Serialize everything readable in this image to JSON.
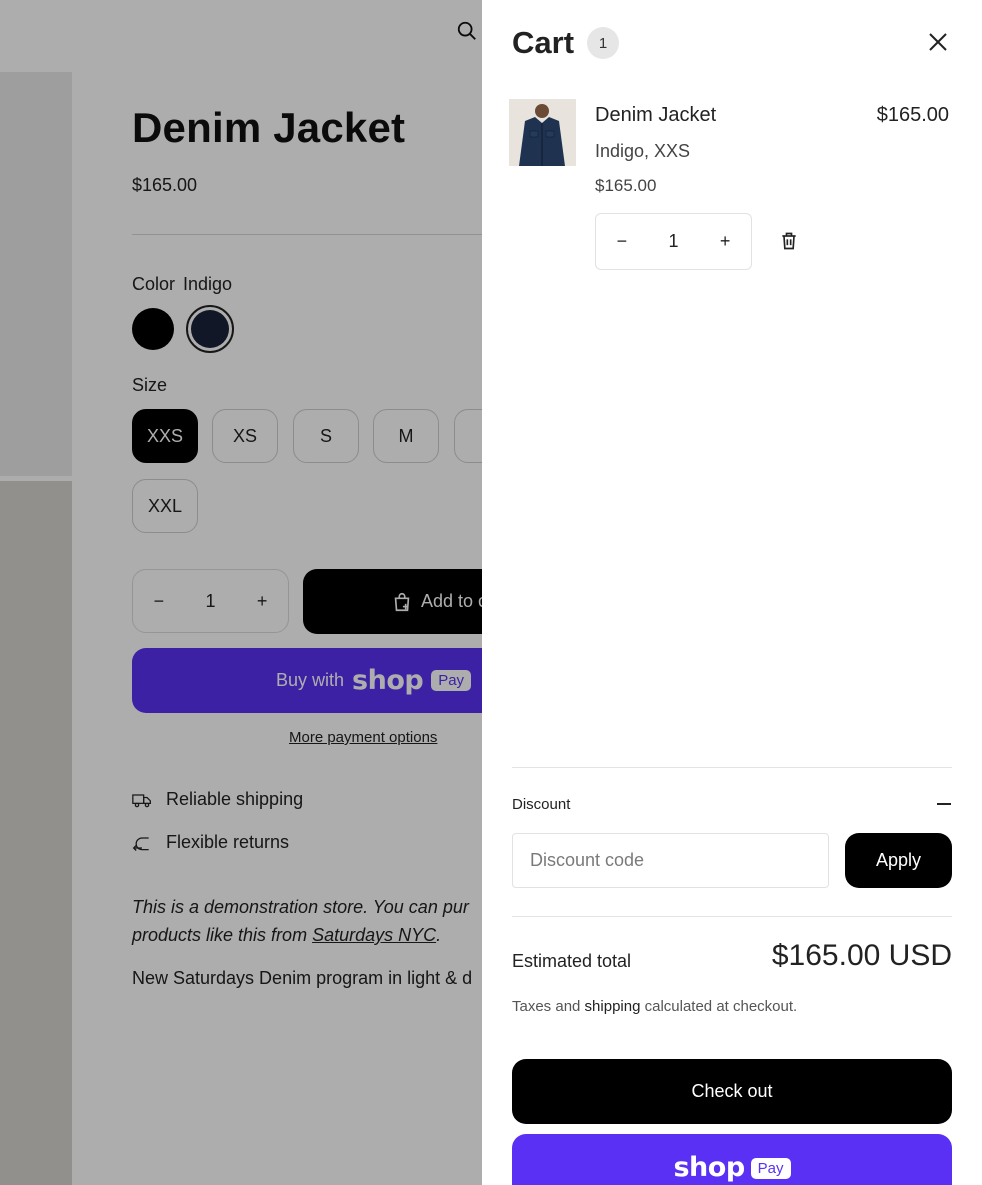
{
  "product": {
    "title": "Denim Jacket",
    "price": "$165.00",
    "color_label": "Color",
    "color_value": "Indigo",
    "size_label": "Size",
    "sizes": [
      "XXS",
      "XS",
      "S",
      "M",
      "XXL"
    ],
    "selected_size": "XXS",
    "quantity": "1",
    "add_to_cart_label": "Add to c",
    "buy_with_label": "Buy with",
    "shop_word": "shop",
    "pay_word": "Pay",
    "more_payment_options": "More payment options",
    "features": [
      "Reliable shipping",
      "Flexible returns"
    ],
    "description_italic_1": "This is a demonstration store. You can pur",
    "description_italic_2_prefix": "products like this from ",
    "description_link": "Saturdays NYC",
    "description_italic_2_suffix": ".",
    "description_plain": "New Saturdays Denim program in light & d"
  },
  "cart": {
    "title": "Cart",
    "count": "1",
    "item": {
      "name": "Denim Jacket",
      "line_price": "$165.00",
      "variant": "Indigo, XXS",
      "unit_price": "$165.00",
      "quantity": "1"
    },
    "discount_label": "Discount",
    "discount_placeholder": "Discount code",
    "apply_label": "Apply",
    "estimated_total_label": "Estimated total",
    "estimated_total_value": "$165.00 USD",
    "tax_note_prefix": "Taxes and ",
    "tax_note_link": "shipping",
    "tax_note_suffix": " calculated at checkout.",
    "checkout_label": "Check out",
    "shop_word": "shop",
    "pay_word": "Pay"
  },
  "colors": {
    "shop_pay_purple": "#5a31f4",
    "indigo_swatch": "#1a2238",
    "overlay": "rgba(0,0,0,0.32)"
  }
}
